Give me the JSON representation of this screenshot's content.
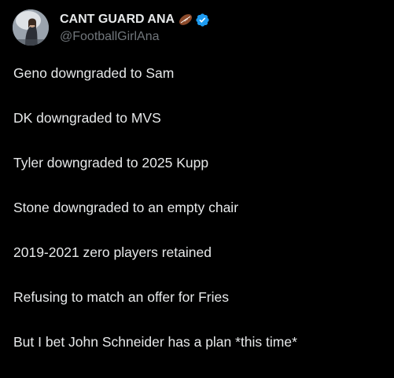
{
  "tweet": {
    "author": {
      "display_name": "CANT GUARD ANA",
      "handle": "@FootballGirlAna",
      "emoji_icon": "football-icon",
      "verified_icon": "verified-badge-icon",
      "verified_color": "#1d9bf0"
    },
    "lines": [
      "Geno downgraded to Sam",
      "DK downgraded to MVS",
      "Tyler downgraded to 2025 Kupp",
      "Stone downgraded to an empty chair",
      "2019-2021 zero players retained",
      "Refusing to match an offer for Fries",
      "But I bet John Schneider has a plan *this time*"
    ]
  },
  "theme": {
    "background": "#000000",
    "text_primary": "#e7e9ea",
    "text_secondary": "#71767b"
  }
}
